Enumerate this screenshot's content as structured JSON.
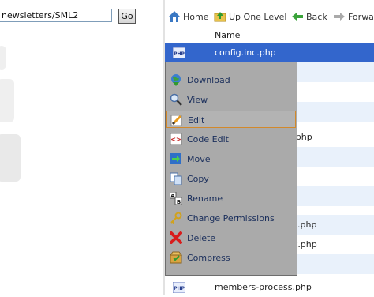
{
  "path_bar": {
    "value": "newsletters/SML2",
    "go_label": "Go"
  },
  "toolbar": {
    "home": "Home",
    "up": "Up One Level",
    "back": "Back",
    "forward": "Forward"
  },
  "file_list": {
    "column_name": "Name",
    "rows": [
      {
        "name": "config.inc.php",
        "icon": "php-file-icon",
        "selected": true
      },
      {
        "name": "",
        "alt": true
      },
      {
        "name": ""
      },
      {
        "name": "",
        "alt": true
      },
      {
        "name": "t.php"
      },
      {
        "name": "",
        "alt": true
      },
      {
        "name": ""
      },
      {
        "name": "",
        "alt": true
      },
      {
        "name": ""
      },
      {
        "name": ".php",
        "alt": true
      },
      {
        "name": "t.php"
      },
      {
        "name": "",
        "alt": true
      },
      {
        "name": "members-process.php",
        "icon": "php-file-icon"
      }
    ]
  },
  "context_menu": {
    "items": [
      {
        "label": "Download",
        "icon": "globe-download-icon"
      },
      {
        "label": "View",
        "icon": "magnifier-icon"
      },
      {
        "label": "Edit",
        "icon": "pencil-edit-icon",
        "hover": true
      },
      {
        "label": "Code Edit",
        "icon": "code-edit-icon"
      },
      {
        "label": "Move",
        "icon": "move-arrow-icon"
      },
      {
        "label": "Copy",
        "icon": "copy-pages-icon"
      },
      {
        "label": "Rename",
        "icon": "rename-ab-icon"
      },
      {
        "label": "Change Permissions",
        "icon": "key-icon"
      },
      {
        "label": "Delete",
        "icon": "red-x-delete-icon"
      },
      {
        "label": "Compress",
        "icon": "compress-box-icon"
      }
    ]
  },
  "colors": {
    "selection": "#3366cc",
    "menu_bg": "#aaaaaa",
    "menu_text": "#1b2f5c",
    "hover_border": "#d2892b",
    "alt_row": "#e9f1fb"
  }
}
